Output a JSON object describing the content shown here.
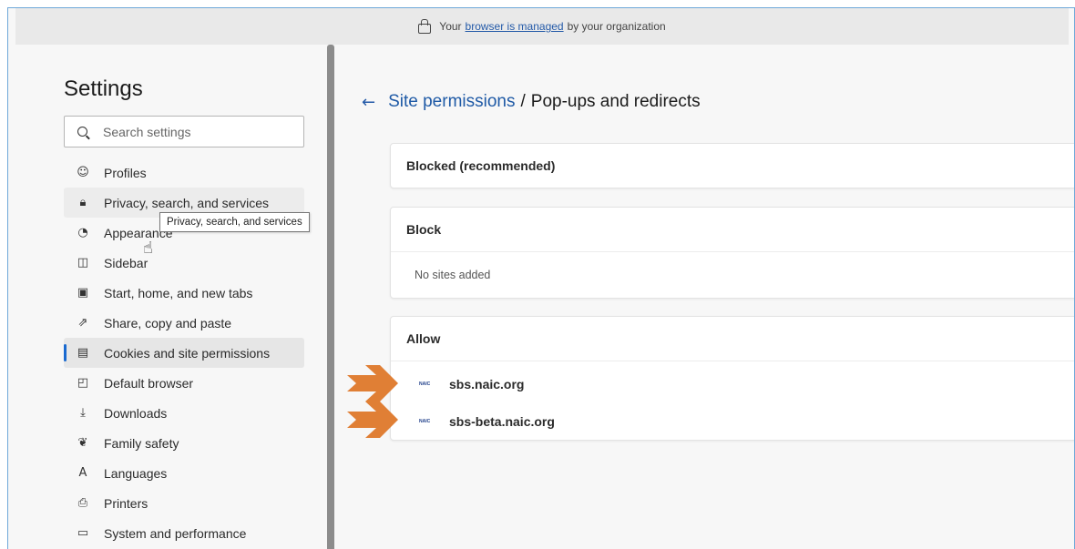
{
  "banner": {
    "prefix": "Your",
    "link": "browser is managed",
    "suffix": "by your organization"
  },
  "sidebar": {
    "title": "Settings",
    "search_placeholder": "Search settings",
    "items": [
      {
        "label": "Profiles",
        "icon": "profile-icon"
      },
      {
        "label": "Privacy, search, and services",
        "icon": "lock-icon"
      },
      {
        "label": "Appearance",
        "icon": "palette-icon"
      },
      {
        "label": "Sidebar",
        "icon": "sidebar-icon"
      },
      {
        "label": "Start, home, and new tabs",
        "icon": "home-icon"
      },
      {
        "label": "Share, copy and paste",
        "icon": "share-icon"
      },
      {
        "label": "Cookies and site permissions",
        "icon": "cookies-icon"
      },
      {
        "label": "Default browser",
        "icon": "browser-icon"
      },
      {
        "label": "Downloads",
        "icon": "download-icon"
      },
      {
        "label": "Family safety",
        "icon": "family-icon"
      },
      {
        "label": "Languages",
        "icon": "languages-icon"
      },
      {
        "label": "Printers",
        "icon": "printer-icon"
      },
      {
        "label": "System and performance",
        "icon": "laptop-icon"
      }
    ],
    "tooltip": "Privacy, search, and services"
  },
  "main": {
    "breadcrumb_parent": "Site permissions",
    "breadcrumb_separator": "/",
    "breadcrumb_current": "Pop-ups and redirects",
    "blocked_toggle_label": "Blocked (recommended)",
    "block_section": {
      "title": "Block",
      "empty": "No sites added"
    },
    "allow_section": {
      "title": "Allow",
      "sites": [
        {
          "favicon": "NAIC",
          "name": "sbs.naic.org"
        },
        {
          "favicon": "NAIC",
          "name": "sbs-beta.naic.org"
        }
      ]
    }
  },
  "colors": {
    "accent": "#1f5aa6",
    "annotation_arrow": "#e07f35"
  }
}
